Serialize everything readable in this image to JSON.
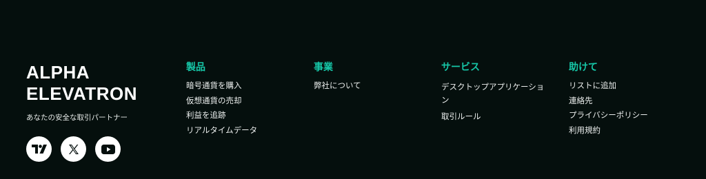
{
  "brand": {
    "name": "ALPHA\nELEVATRON",
    "tagline": "あなたの安全な取引パートナー",
    "socials": [
      {
        "icon": "tradingview-icon"
      },
      {
        "icon": "x-icon"
      },
      {
        "icon": "youtube-icon"
      }
    ]
  },
  "accent_color": "#16c7a8",
  "columns": [
    {
      "heading": "製品",
      "links": [
        "暗号通貨を購入",
        "仮想通貨の売却",
        "利益を追跡",
        "リアルタイムデータ"
      ]
    },
    {
      "heading": "事業",
      "links": [
        "弊社について"
      ]
    },
    {
      "heading": "サービス",
      "links": [
        "デスクトップアプリケーション",
        "取引ルール"
      ]
    },
    {
      "heading": "助けて",
      "links": [
        "リストに追加",
        "連絡先",
        "プライバシーポリシー",
        "利用規約"
      ]
    }
  ]
}
